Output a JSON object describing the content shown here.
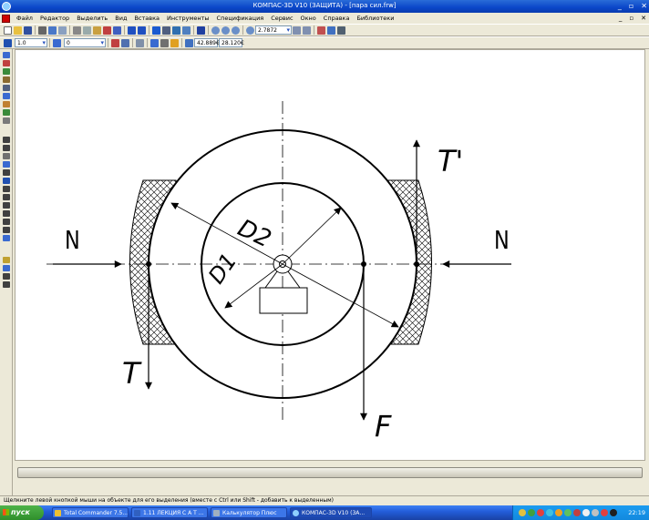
{
  "window": {
    "title": "КОМПАС-3D V10 (ЗАЩИТА) - [пара сил.frw]"
  },
  "menu": [
    {
      "id": "file",
      "label": "Файл"
    },
    {
      "id": "edit",
      "label": "Редактор"
    },
    {
      "id": "select",
      "label": "Выделить"
    },
    {
      "id": "view",
      "label": "Вид"
    },
    {
      "id": "insert",
      "label": "Вставка"
    },
    {
      "id": "tools",
      "label": "Инструменты"
    },
    {
      "id": "spec",
      "label": "Спецификация"
    },
    {
      "id": "service",
      "label": "Сервис"
    },
    {
      "id": "window",
      "label": "Окно"
    },
    {
      "id": "help",
      "label": "Справка"
    },
    {
      "id": "libraries",
      "label": "Библиотеки"
    }
  ],
  "toolbar": {
    "zoom_value": "2.7872"
  },
  "props_toolbar": {
    "line_width": "1.0",
    "layer": "0",
    "coord_x": "42.889€",
    "coord_y": "28.120€"
  },
  "drawing": {
    "label_N_left": "N",
    "label_N_right": "N",
    "label_D2": "D2",
    "label_D1": "D1",
    "label_T": "T",
    "label_T_prime": "T'",
    "label_F": "F"
  },
  "status": {
    "hint": "Щелкните левой кнопкой мыши на объекте для его выделения (вместе с Ctrl или Shift - добавить к выделенным)"
  },
  "taskbar": {
    "start_label": "пуск",
    "tasks": [
      {
        "label": "Total Commander 7.5..."
      },
      {
        "label": "1.11 ЛЕКЦИЯ С А Т ..."
      },
      {
        "label": "Калькулятор Плюс"
      },
      {
        "label": "КОМПАС-3D V10 (ЗА..."
      }
    ],
    "clock": "22:19"
  },
  "colors": {
    "title_blue": "#0a46c8",
    "taskbar_blue": "#245edb",
    "start_green": "#2f8f2b"
  }
}
